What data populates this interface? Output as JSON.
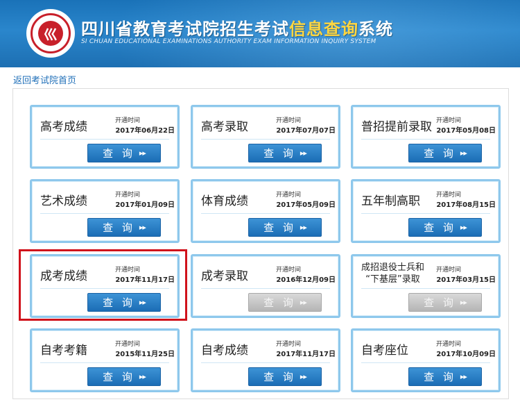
{
  "header": {
    "title_main": "四川省教育考试院招生考试",
    "title_highlight": "信息查询",
    "title_tail": "系统",
    "subtitle": "SI CHUAN EDUCATIONAL EXAMINATIONS AUTHORITY EXAM INFORMATION INQUIRY SYSTEM",
    "logo_glyph": "巛"
  },
  "nav": {
    "back_link": "返回考试院首页"
  },
  "labels": {
    "open_time": "开通时间",
    "query": "查 询",
    "arrows": "▸▸"
  },
  "cards": [
    {
      "name": "高考成绩",
      "date": "2017年06月22日",
      "enabled": true
    },
    {
      "name": "高考录取",
      "date": "2017年07月07日",
      "enabled": true
    },
    {
      "name": "普招提前录取",
      "date": "2017年05月08日",
      "enabled": true
    },
    {
      "name": "艺术成绩",
      "date": "2017年01月09日",
      "enabled": true
    },
    {
      "name": "体育成绩",
      "date": "2017年05月09日",
      "enabled": true
    },
    {
      "name": "五年制高职",
      "date": "2017年08月15日",
      "enabled": true
    },
    {
      "name": "成考成绩",
      "date": "2017年11月17日",
      "enabled": true
    },
    {
      "name": "成考录取",
      "date": "2016年12月09日",
      "enabled": false
    },
    {
      "name_line1": "成招退役士兵和",
      "name_line2": "“下基层”录取",
      "date": "2017年03月15日",
      "enabled": false
    },
    {
      "name": "自考考籍",
      "date": "2015年11月25日",
      "enabled": true
    },
    {
      "name": "自考成绩",
      "date": "2017年11月17日",
      "enabled": true
    },
    {
      "name": "自考座位",
      "date": "2017年10月09日",
      "enabled": true
    }
  ],
  "colors": {
    "header_blue": "#1a72b8",
    "title_highlight": "#ffd640",
    "button_blue": "#1b6db5",
    "button_disabled": "#b5b5b5",
    "card_border": "#8ec8ec",
    "highlight_red": "#d0121b",
    "link_blue": "#1f6fb8"
  }
}
